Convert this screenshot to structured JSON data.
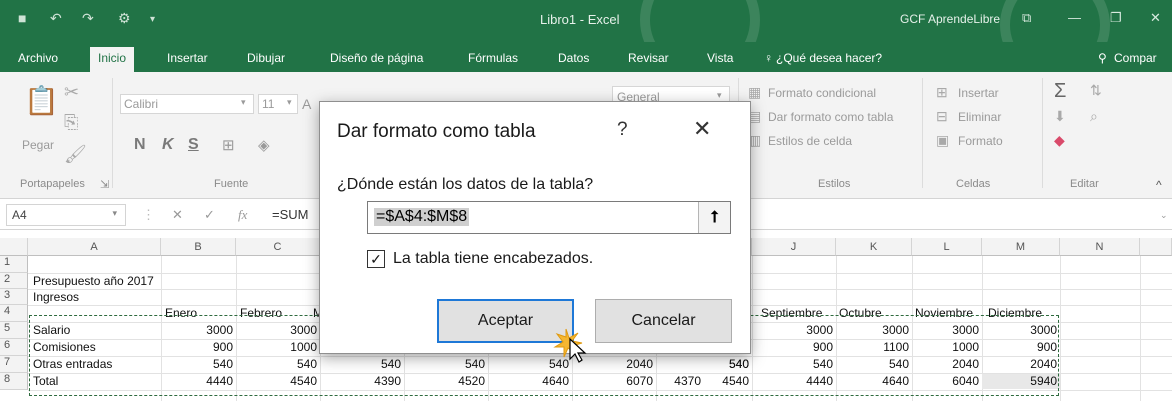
{
  "titlebar": {
    "doc_title": "Libro1  -  Excel",
    "brand": "GCF AprendeLibre",
    "qat_icons": [
      "save-icon",
      "undo-icon",
      "redo-icon",
      "customize-icon"
    ],
    "window_controls": [
      "ribbon-display-icon",
      "minimize-icon",
      "restore-icon",
      "close-icon"
    ]
  },
  "tabs": [
    "Archivo",
    "Inicio",
    "Insertar",
    "Dibujar",
    "Diseño de página",
    "Fórmulas",
    "Datos",
    "Revisar",
    "Vista"
  ],
  "tell_me": "¿Qué desea hacer?",
  "share": "Compar",
  "ribbon": {
    "clipboard": {
      "paste_label": "Pegar",
      "group_label": "Portapapeles"
    },
    "font": {
      "font_name": "Calibri",
      "font_size": "11",
      "bold": "N",
      "italic": "K",
      "underline": "S",
      "group_label": "Fuente"
    },
    "number": {
      "format": "General"
    },
    "styles": {
      "conditional": "Formato condicional",
      "as_table": "Dar formato como tabla",
      "cell_styles": "Estilos de celda",
      "group_label": "Estilos"
    },
    "cells": {
      "insert": "Insertar",
      "delete": "Eliminar",
      "format": "Formato",
      "group_label": "Celdas"
    },
    "editing": {
      "group_label": "Editar"
    }
  },
  "formula_bar": {
    "name_box": "A4",
    "fx": "fx",
    "content": "=SUM"
  },
  "grid": {
    "columns": [
      "A",
      "B",
      "C",
      "J",
      "K",
      "L",
      "M",
      "N"
    ],
    "rows": [
      "1",
      "2",
      "3",
      "4",
      "5",
      "6",
      "7",
      "8"
    ],
    "title": "Presupuesto año 2017",
    "section": "Ingresos",
    "left_headers": [
      "Enero",
      "Febrero",
      "M"
    ],
    "right_headers": [
      "Septiembre",
      "Octubre",
      "Noviembre",
      "Diciembre"
    ],
    "row_labels": [
      "Salario",
      "Comisiones",
      "Otras entradas",
      "Total"
    ],
    "left_values": [
      [
        "3000",
        "3000"
      ],
      [
        "900",
        "1000"
      ],
      [
        "540",
        "540",
        "540",
        "540",
        "540",
        "2040",
        "540",
        "540"
      ],
      [
        "4440",
        "4540",
        "4390",
        "4520",
        "4640",
        "6070",
        "4370",
        "4540"
      ]
    ],
    "partial_values": [
      "00",
      "00"
    ],
    "right_values": [
      [
        "3000",
        "3000",
        "3000",
        "3000"
      ],
      [
        "900",
        "1100",
        "1000",
        "900"
      ],
      [
        "540",
        "540",
        "2040",
        "2040"
      ],
      [
        "4440",
        "4640",
        "6040",
        "5940"
      ]
    ]
  },
  "dialog": {
    "title": "Dar formato como tabla",
    "help": "?",
    "close": "✕",
    "question": "¿Dónde están los datos de la tabla?",
    "range": "=$A$4:$M$8",
    "checkbox_checked": true,
    "checkbox_label": "La tabla tiene encabezados.",
    "ok": "Aceptar",
    "cancel": "Cancelar"
  },
  "colors": {
    "excel_green": "#217346",
    "accent_blue": "#1e78d7"
  }
}
